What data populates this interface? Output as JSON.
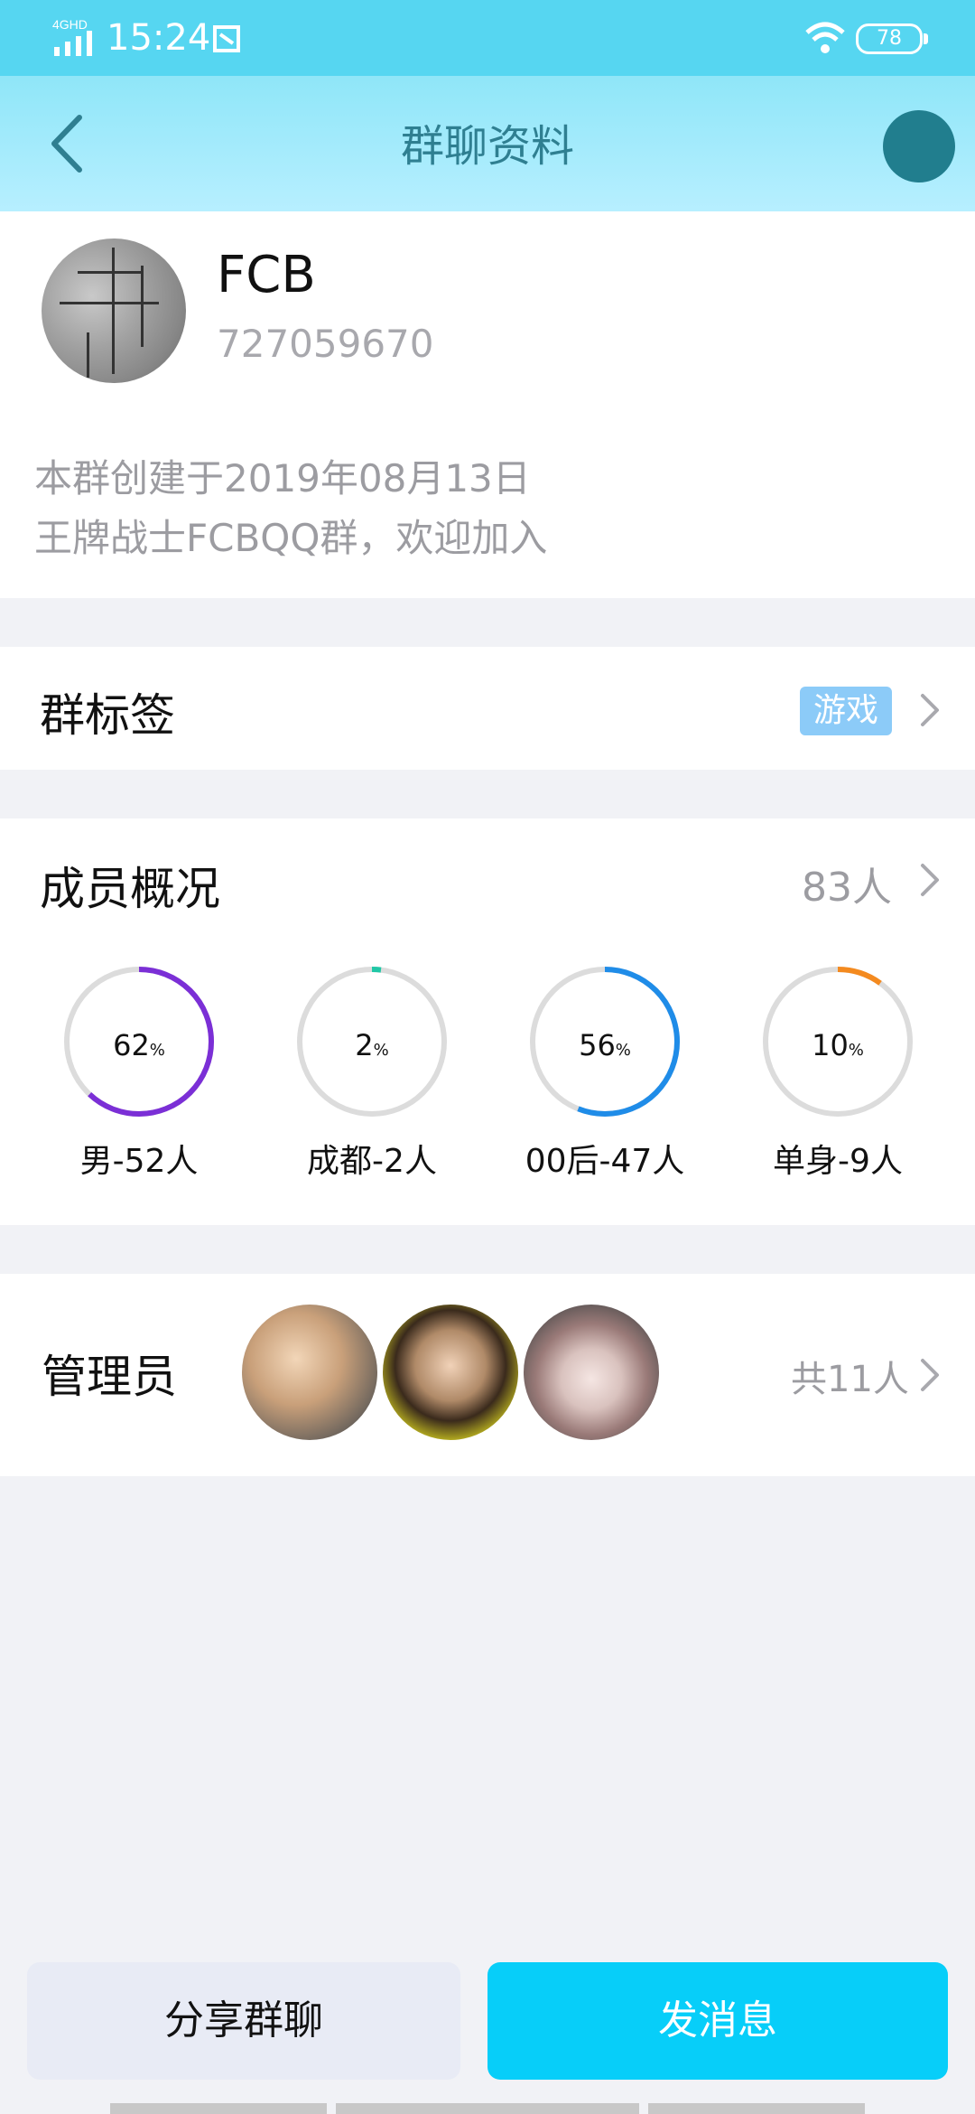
{
  "status_bar": {
    "network": "4GHD",
    "time": "15:24",
    "battery": "78"
  },
  "header": {
    "title": "群聊资料"
  },
  "group": {
    "name": "FCB",
    "id": "727059670",
    "created_text": "本群创建于2019年08月13日",
    "description": "王牌战士FCBQQ群，欢迎加入"
  },
  "tags": {
    "title": "群标签",
    "badge": "游戏"
  },
  "members": {
    "title": "成员概况",
    "count": "83人",
    "stats": [
      {
        "percent": "62",
        "label": "男-52人",
        "fraction": 0.62,
        "color": "#7b2fd6"
      },
      {
        "percent": "2",
        "label": "成都-2人",
        "fraction": 0.02,
        "color": "#20c7a6"
      },
      {
        "percent": "56",
        "label": "00后-47人",
        "fraction": 0.56,
        "color": "#1f8ce8"
      },
      {
        "percent": "10",
        "label": "单身-9人",
        "fraction": 0.1,
        "color": "#f48a1f"
      }
    ],
    "percent_sign": "%"
  },
  "admins": {
    "title": "管理员",
    "count": "共11人"
  },
  "buttons": {
    "share": "分享群聊",
    "send": "发消息"
  }
}
